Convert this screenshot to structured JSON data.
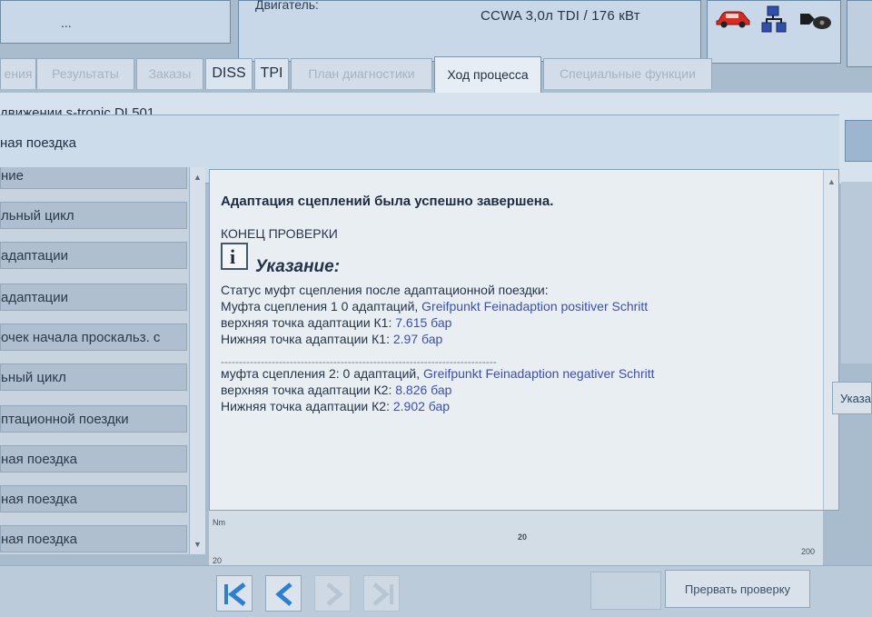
{
  "header": {
    "left_value": "...",
    "engine_label": "Двигатель:",
    "engine_value": "CCWA 3,0л TDI / 176 кВт"
  },
  "icons": {
    "car": "car-icon",
    "network": "network-icon",
    "key": "key-icon"
  },
  "tabs": [
    {
      "label": "ения",
      "state": "dim"
    },
    {
      "label": "Результаты",
      "state": "dim"
    },
    {
      "label": "Заказы",
      "state": "dim"
    },
    {
      "label": "DISS",
      "state": "normal"
    },
    {
      "label": "TPI",
      "state": "normal"
    },
    {
      "label": "План диагностики",
      "state": "dim"
    },
    {
      "label": "Ход процесса",
      "state": "active"
    },
    {
      "label": "Специальные функции",
      "state": "dim"
    }
  ],
  "title": {
    "line1": "движении s-tronic DL501",
    "line2": "ная поездка"
  },
  "steps": [
    "ние",
    "льный цикл",
    "адаптации",
    "адаптации",
    "очек начала проскальз. с",
    "ьный цикл",
    "птационной поездки",
    "ная поездка",
    "ная поездка",
    "ная поездка"
  ],
  "content": {
    "success": "Адаптация сцеплений была успешно завершена.",
    "end_test": "КОНЕЦ ПРОВЕРКИ",
    "info_glyph": "i",
    "note_title": "Указание:",
    "status_line": "Статус муфт сцепления после адаптационной поездки:",
    "clutch1_prefix": "Муфта сцепления 1 0  адаптаций, ",
    "clutch1_name": "Greifpunkt Feinadaption positiver Schritt",
    "k1_upper_prefix": "верхняя точка адаптации К1: ",
    "k1_upper_value": "7.615  бар",
    "k1_lower_prefix": "Нижняя точка адаптации К1: ",
    "k1_lower_value": "2.97  бар",
    "separator": "----------------------------------------------------------------------------",
    "clutch2_prefix": "муфта сцепления 2: 0  адаптаций, ",
    "clutch2_name": "Greifpunkt Feinadaption negativer Schritt",
    "k2_upper_prefix": "верхняя точка адаптации К2: ",
    "k2_upper_value": "8.826  бар",
    "k2_lower_prefix": "Нижняя точка адаптации К2: ",
    "k2_lower_value": "2.902  бар"
  },
  "chart": {
    "unit": "Nm",
    "mid_tick": "20",
    "left_tick": "20",
    "right_tick": "200"
  },
  "bottom": {
    "abort_label": "Прервать проверку",
    "right_button_label": "Указа"
  }
}
